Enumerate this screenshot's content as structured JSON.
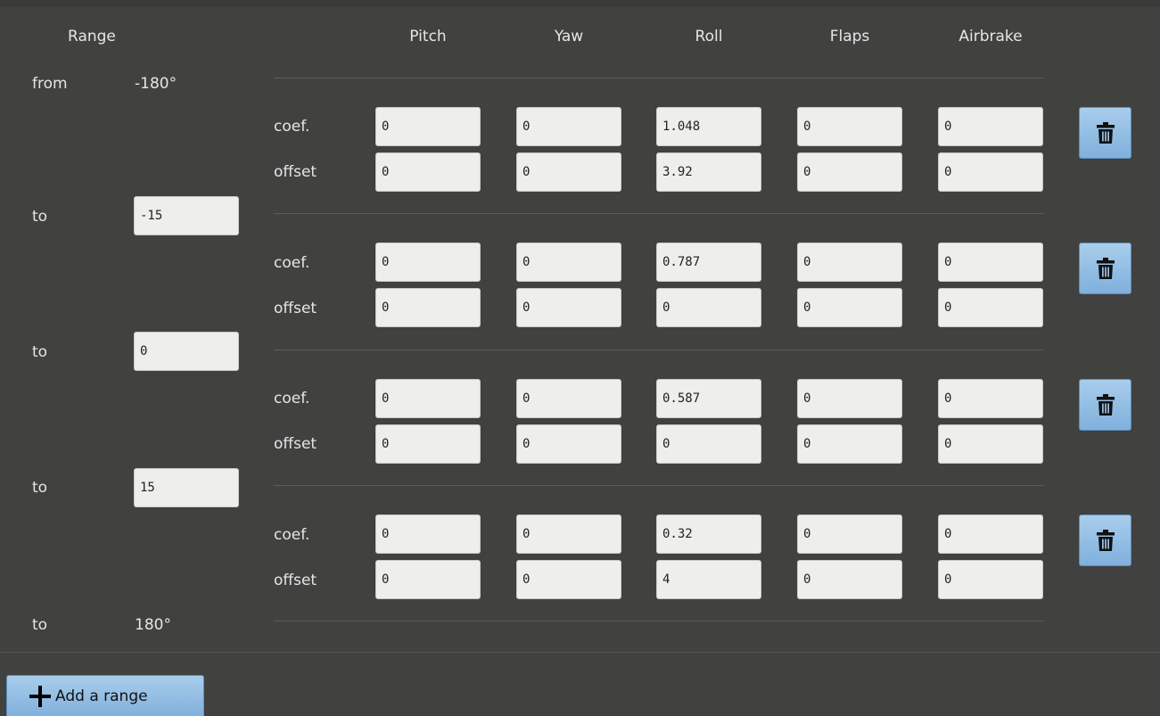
{
  "header": {
    "range": "Range",
    "columns": [
      "Pitch",
      "Yaw",
      "Roll",
      "Flaps",
      "Airbrake"
    ]
  },
  "range": {
    "from_label": "from",
    "from_value": "-180°",
    "to_label": "to",
    "breakpoints": [
      "-15",
      "0",
      "15"
    ],
    "end_value": "180°"
  },
  "row_labels": {
    "coef": "coef.",
    "offset": "offset"
  },
  "blocks": [
    {
      "coef": [
        "0",
        "0",
        "1.048",
        "0",
        "0"
      ],
      "offset": [
        "0",
        "0",
        "3.92",
        "0",
        "0"
      ]
    },
    {
      "coef": [
        "0",
        "0",
        "0.787",
        "0",
        "0"
      ],
      "offset": [
        "0",
        "0",
        "0",
        "0",
        "0"
      ]
    },
    {
      "coef": [
        "0",
        "0",
        "0.587",
        "0",
        "0"
      ],
      "offset": [
        "0",
        "0",
        "0",
        "0",
        "0"
      ]
    },
    {
      "coef": [
        "0",
        "0",
        "0.32",
        "0",
        "0"
      ],
      "offset": [
        "0",
        "0",
        "4",
        "0",
        "0"
      ]
    }
  ],
  "icons": {
    "delete": "trash-icon",
    "add": "plus-icon"
  },
  "buttons": {
    "add_range": "Add a range"
  },
  "colors": {
    "background": "#414140",
    "button": "#93bfe6",
    "input": "#eeeeec"
  }
}
